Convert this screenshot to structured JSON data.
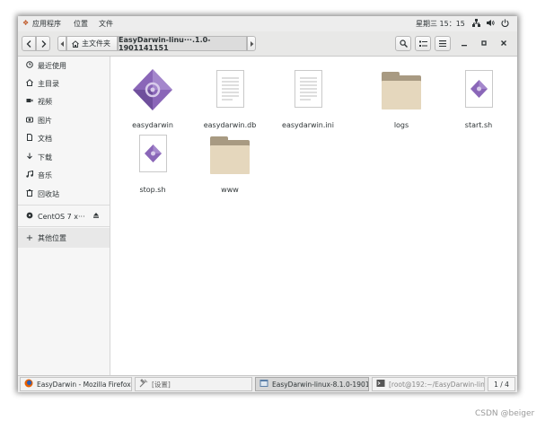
{
  "topbar": {
    "apps_label": "应用程序",
    "places_label": "位置",
    "files_label": "文件",
    "clock": "星期三 15：15"
  },
  "toolbar": {
    "crumb_home": "主文件夹",
    "crumb_current": "EasyDarwin-linu···.1.0-1901141151"
  },
  "sidebar": {
    "items": [
      {
        "label": "最近使用",
        "icon": "clock-icon"
      },
      {
        "label": "主目录",
        "icon": "home-icon"
      },
      {
        "label": "视频",
        "icon": "video-icon"
      },
      {
        "label": "图片",
        "icon": "camera-icon"
      },
      {
        "label": "文档",
        "icon": "document-icon"
      },
      {
        "label": "下载",
        "icon": "download-icon"
      },
      {
        "label": "音乐",
        "icon": "music-icon"
      },
      {
        "label": "回收站",
        "icon": "trash-icon"
      },
      {
        "label": "CentOS 7 x···",
        "icon": "disc-icon"
      },
      {
        "label": "其他位置",
        "icon": "plus-icon"
      }
    ]
  },
  "files": [
    {
      "name": "easydarwin",
      "type": "executable"
    },
    {
      "name": "easydarwin.db",
      "type": "text"
    },
    {
      "name": "easydarwin.ini",
      "type": "text"
    },
    {
      "name": "logs",
      "type": "folder"
    },
    {
      "name": "start.sh",
      "type": "script"
    },
    {
      "name": "stop.sh",
      "type": "script"
    },
    {
      "name": "www",
      "type": "folder"
    }
  ],
  "taskbar": {
    "tasks": [
      {
        "label": "EasyDarwin - Mozilla Firefox",
        "icon": "firefox-icon"
      },
      {
        "label": "[设置]",
        "icon": "settings-icon"
      },
      {
        "label": "EasyDarwin-linux-8.1.0-190114···",
        "icon": "files-icon"
      },
      {
        "label": "[root@192:~/EasyDarwin-linux-···",
        "icon": "terminal-icon"
      }
    ],
    "workspace": "1 / 4"
  },
  "watermark": "CSDN @beiger",
  "colors": {
    "accent_purple": "#8a66b8",
    "folder": "#e5d7bd",
    "folder_dark": "#a89a82"
  }
}
